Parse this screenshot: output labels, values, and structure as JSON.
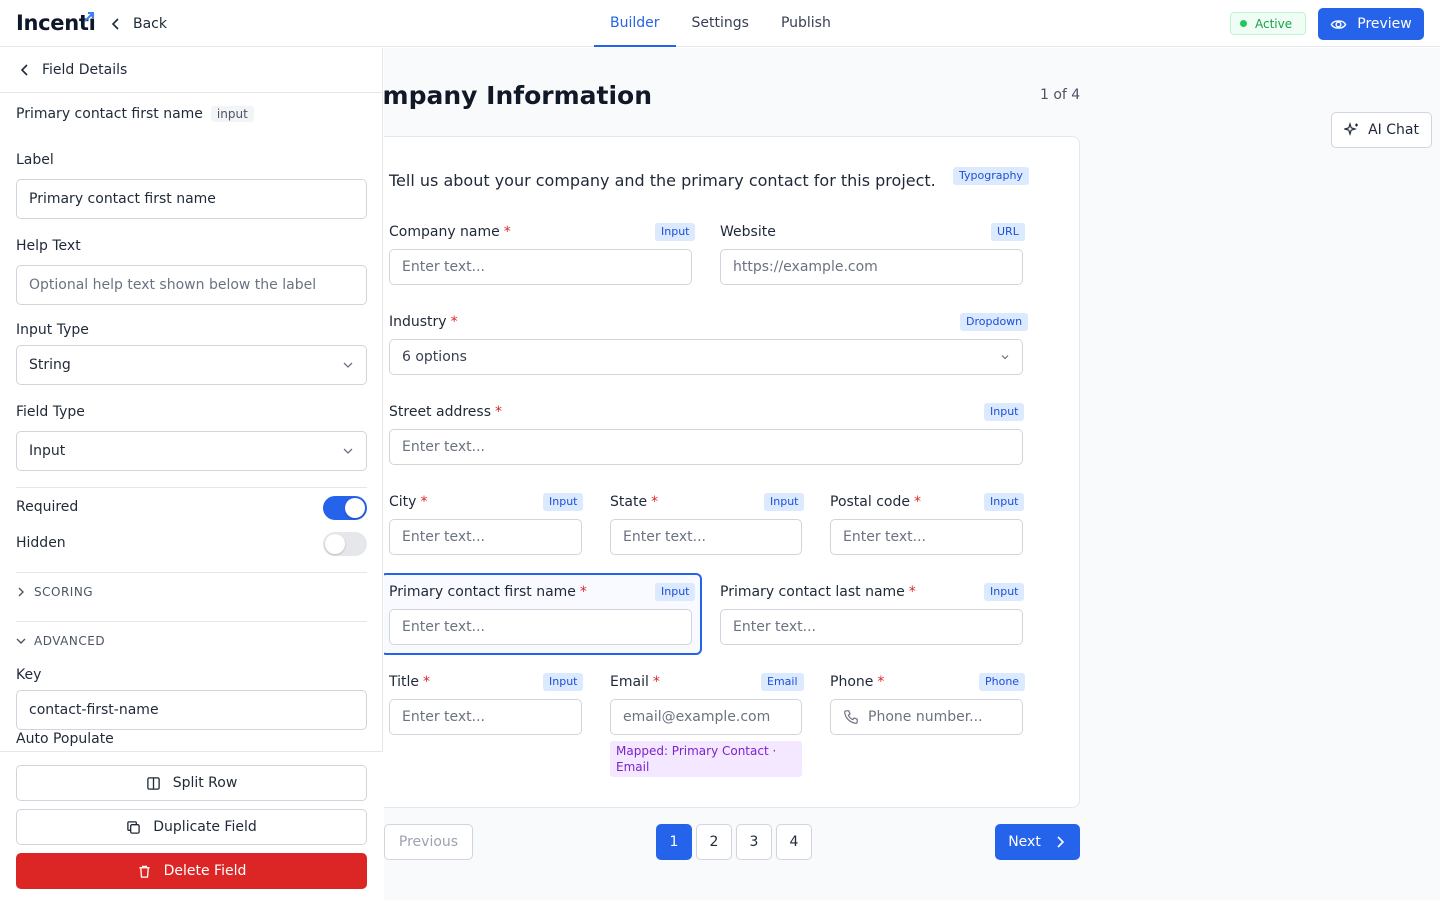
{
  "app": {
    "name": "Incenti",
    "back_label": "Back"
  },
  "header": {
    "tabs": [
      {
        "label": "Builder",
        "active": true
      },
      {
        "label": "Settings",
        "active": false
      },
      {
        "label": "Publish",
        "active": false
      }
    ],
    "status": "Active",
    "preview_label": "Preview",
    "accent_color": "#2563eb",
    "status_color": "#16a34a"
  },
  "sidebar": {
    "title": "Field Details",
    "field_name": "Primary contact first name",
    "field_kind": "input",
    "label": {
      "title": "Label",
      "value": "Primary contact first name"
    },
    "help_text": {
      "title": "Help Text",
      "placeholder": "Optional help text shown below the label"
    },
    "input_type": {
      "title": "Input Type",
      "value": "String"
    },
    "field_type": {
      "title": "Field Type",
      "value": "Input"
    },
    "required": {
      "title": "Required",
      "on": true
    },
    "hidden": {
      "title": "Hidden",
      "on": false
    },
    "scoring_label": "SCORING",
    "advanced_label": "ADVANCED",
    "key": {
      "title": "Key",
      "value": "contact-first-name"
    },
    "auto_populate_label": "Auto Populate",
    "buttons": {
      "split_row": "Split Row",
      "duplicate": "Duplicate Field",
      "delete": "Delete Field"
    },
    "danger_color": "#dc2626"
  },
  "canvas": {
    "page_title": "Company Information",
    "page_counter": "1 of 4",
    "ai_chat_label": "AI Chat",
    "intro": "Tell us about your company and the primary contact for this project.",
    "intro_tag": "Typography",
    "fields": {
      "company_name": {
        "label": "Company name",
        "tag": "Input",
        "placeholder": "Enter text..."
      },
      "website": {
        "label": "Website",
        "tag": "URL",
        "placeholder": "https://example.com"
      },
      "industry": {
        "label": "Industry",
        "tag": "Dropdown",
        "value": "6 options"
      },
      "street": {
        "label": "Street address",
        "tag": "Input",
        "placeholder": "Enter text..."
      },
      "city": {
        "label": "City",
        "tag": "Input",
        "placeholder": "Enter text..."
      },
      "state": {
        "label": "State",
        "tag": "Input",
        "placeholder": "Enter text..."
      },
      "postal": {
        "label": "Postal code",
        "tag": "Input",
        "placeholder": "Enter text..."
      },
      "first_name": {
        "label": "Primary contact first name",
        "tag": "Input",
        "placeholder": "Enter text..."
      },
      "last_name": {
        "label": "Primary contact last name",
        "tag": "Input",
        "placeholder": "Enter text..."
      },
      "title": {
        "label": "Title",
        "tag": "Input",
        "placeholder": "Enter text..."
      },
      "email": {
        "label": "Email",
        "tag": "Email",
        "placeholder": "email@example.com",
        "mapping": "Mapped: Primary Contact · Email"
      },
      "phone": {
        "label": "Phone",
        "tag": "Phone",
        "placeholder": "Phone number..."
      }
    },
    "required_marker": "*",
    "pagination": {
      "previous": "Previous",
      "pages": [
        "1",
        "2",
        "3",
        "4"
      ],
      "current_page": "1",
      "next": "Next"
    }
  }
}
